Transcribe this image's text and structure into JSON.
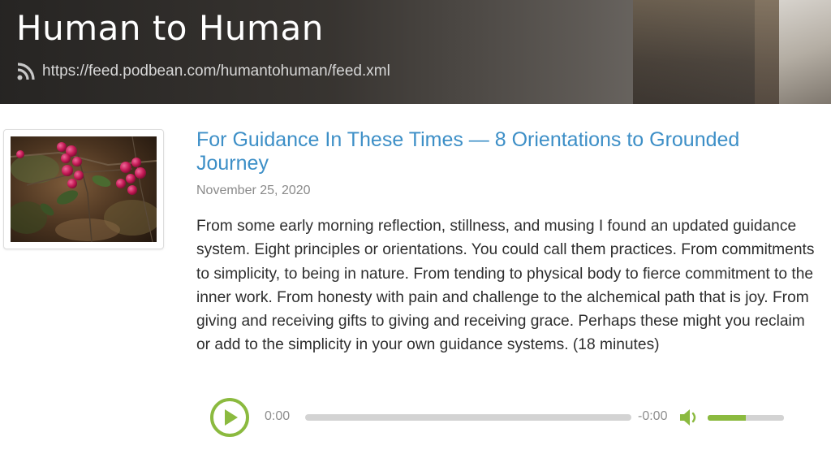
{
  "podcast": {
    "title": "Human to Human",
    "feed_url": "https://feed.podbean.com/humantohuman/feed.xml",
    "feed_icon": "rss-icon"
  },
  "episode": {
    "thumbnail_icon": "berries-photo",
    "title": "For Guidance In These Times — 8 Orientations to Grounded Journey",
    "date": "November 25, 2020",
    "description": "From some early morning reflection, stillness, and musing I found an updated guidance system. Eight principles or orientations. You could call them practices. From commitments to simplicity, to being in nature. From tending to physical body to fierce commitment to the inner work. From honesty with pain and challenge to the alchemical path that is joy. From giving and receiving gifts to giving and receiving grace. Perhaps these might you reclaim or add to the simplicity in your own guidance systems. (18 minutes)"
  },
  "player": {
    "play_icon": "play-icon",
    "current_time": "0:00",
    "remaining_time": "-0:00",
    "progress": 0,
    "volume_icon": "speaker-icon",
    "volume": 0.5,
    "accent_color": "#8bba3f",
    "track_color": "#d3d3d3"
  },
  "colors": {
    "title_link": "#3d8fc7",
    "date_text": "#8a8a8a",
    "body_text": "#2e2e2e"
  }
}
